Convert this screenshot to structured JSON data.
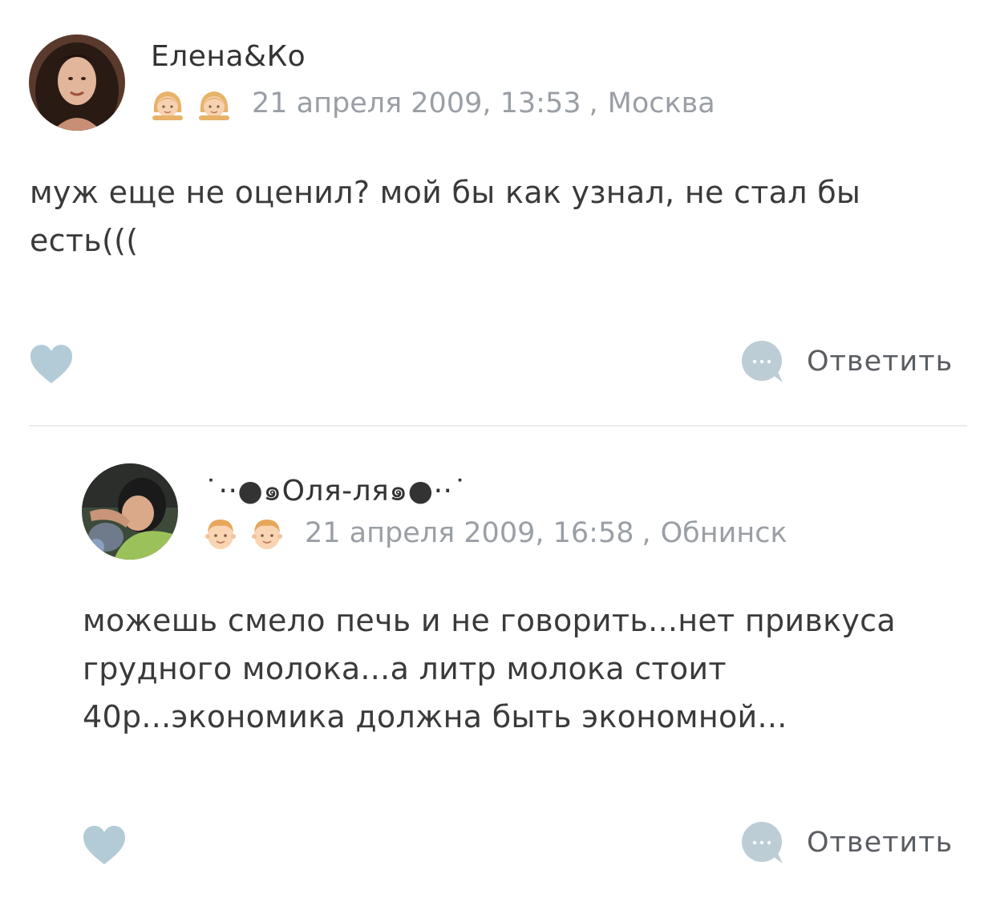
{
  "comments": [
    {
      "author": "Елена&Ко",
      "date": "21 апреля 2009, 13:53",
      "separator": ",",
      "city": "Москва",
      "text": "муж еще не оценил? мой бы как узнал, не стал бы есть(((",
      "reply_label": "Ответить",
      "badge_icon": "girl-face-icon"
    },
    {
      "author": "˙··●๑Оля-ля๑●··˙",
      "date": "21 апреля 2009, 16:58",
      "separator": ",",
      "city": "Обнинск",
      "text": "можешь смело печь и не говорить...нет привкуса грудного молока...а литр молока стоит 40р...экономика должна быть экономной...",
      "reply_label": "Ответить",
      "badge_icon": "boy-face-icon"
    }
  ],
  "colors": {
    "like_heart": "#b3cbd6",
    "reply_bubble": "#bccdd6",
    "meta_text": "#9a9fa6",
    "divider": "#e9ebee"
  }
}
